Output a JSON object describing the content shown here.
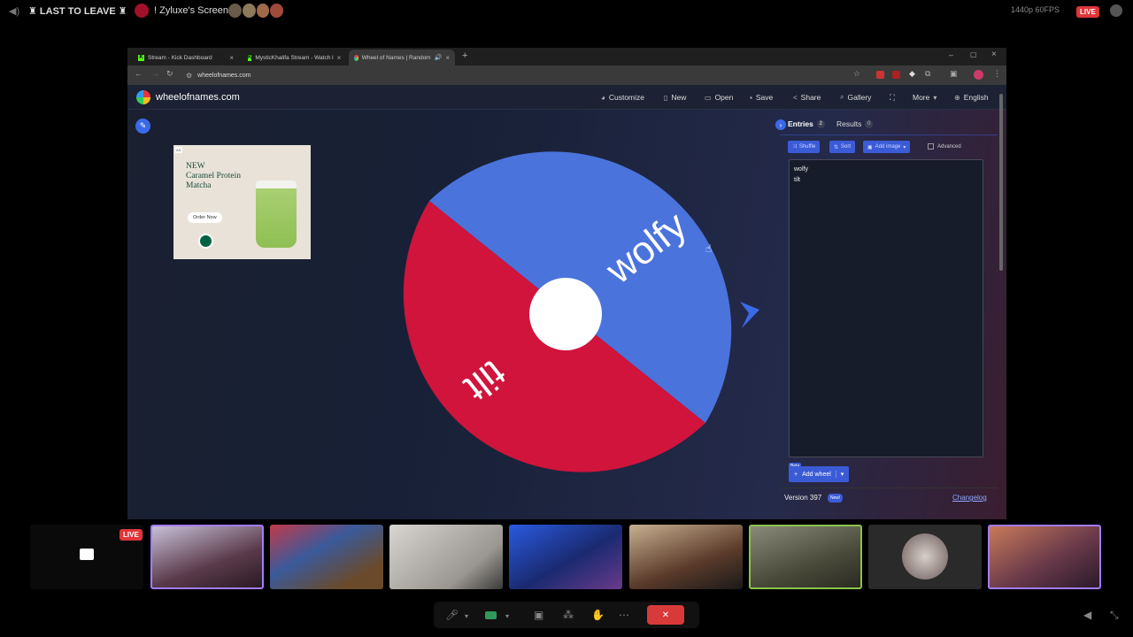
{
  "discord_top": {
    "left_title": "♜ LAST TO LEAVE ♜",
    "screen_title": "! Zyluxe's Screen",
    "quality": "1440p 60FPS",
    "live": "LIVE"
  },
  "tabs": [
    {
      "label": "Stream - Kick Dashboard",
      "active": false
    },
    {
      "label": "MysticKhalifa Stream - Watch l",
      "active": false
    },
    {
      "label": "Wheel of Names | Random",
      "active": true
    }
  ],
  "address": {
    "url": "wheelofnames.com"
  },
  "wheelbar": {
    "site_name": "wheelofnames.com",
    "menu": [
      "Customize",
      "New",
      "Open",
      "Save",
      "Share",
      "Gallery",
      "More",
      "English"
    ]
  },
  "ad": {
    "badge": "AD",
    "headline": "NEW\nCaramel Protein\nMatcha",
    "cta": "Order Now"
  },
  "wheel": {
    "segments": [
      {
        "label": "wolfy",
        "color": "#4a73dc"
      },
      {
        "label": "tilt",
        "color": "#d0143c"
      }
    ],
    "pointer_color": "#3b6ae8",
    "center_color": "#ffffff"
  },
  "panel": {
    "entries_tab": "Entries",
    "entries_count": "2",
    "results_tab": "Results",
    "results_count": "0",
    "shuffle": "Shuffle",
    "sort": "Sort",
    "add_image": "Add image",
    "advanced": "Advanced",
    "entries": [
      "wolfy",
      "tilt"
    ],
    "beta": "Beta",
    "add_wheel": "Add wheel",
    "version": "Version 397",
    "new_badge": "New!",
    "changelog": "Changelog"
  },
  "meeting": {
    "live_badge": "LIVE"
  },
  "colors": {
    "accent": "#3b5bd6",
    "wheel_blue": "#4a73dc",
    "wheel_red": "#d0143c",
    "live_red": "#e0353a"
  }
}
